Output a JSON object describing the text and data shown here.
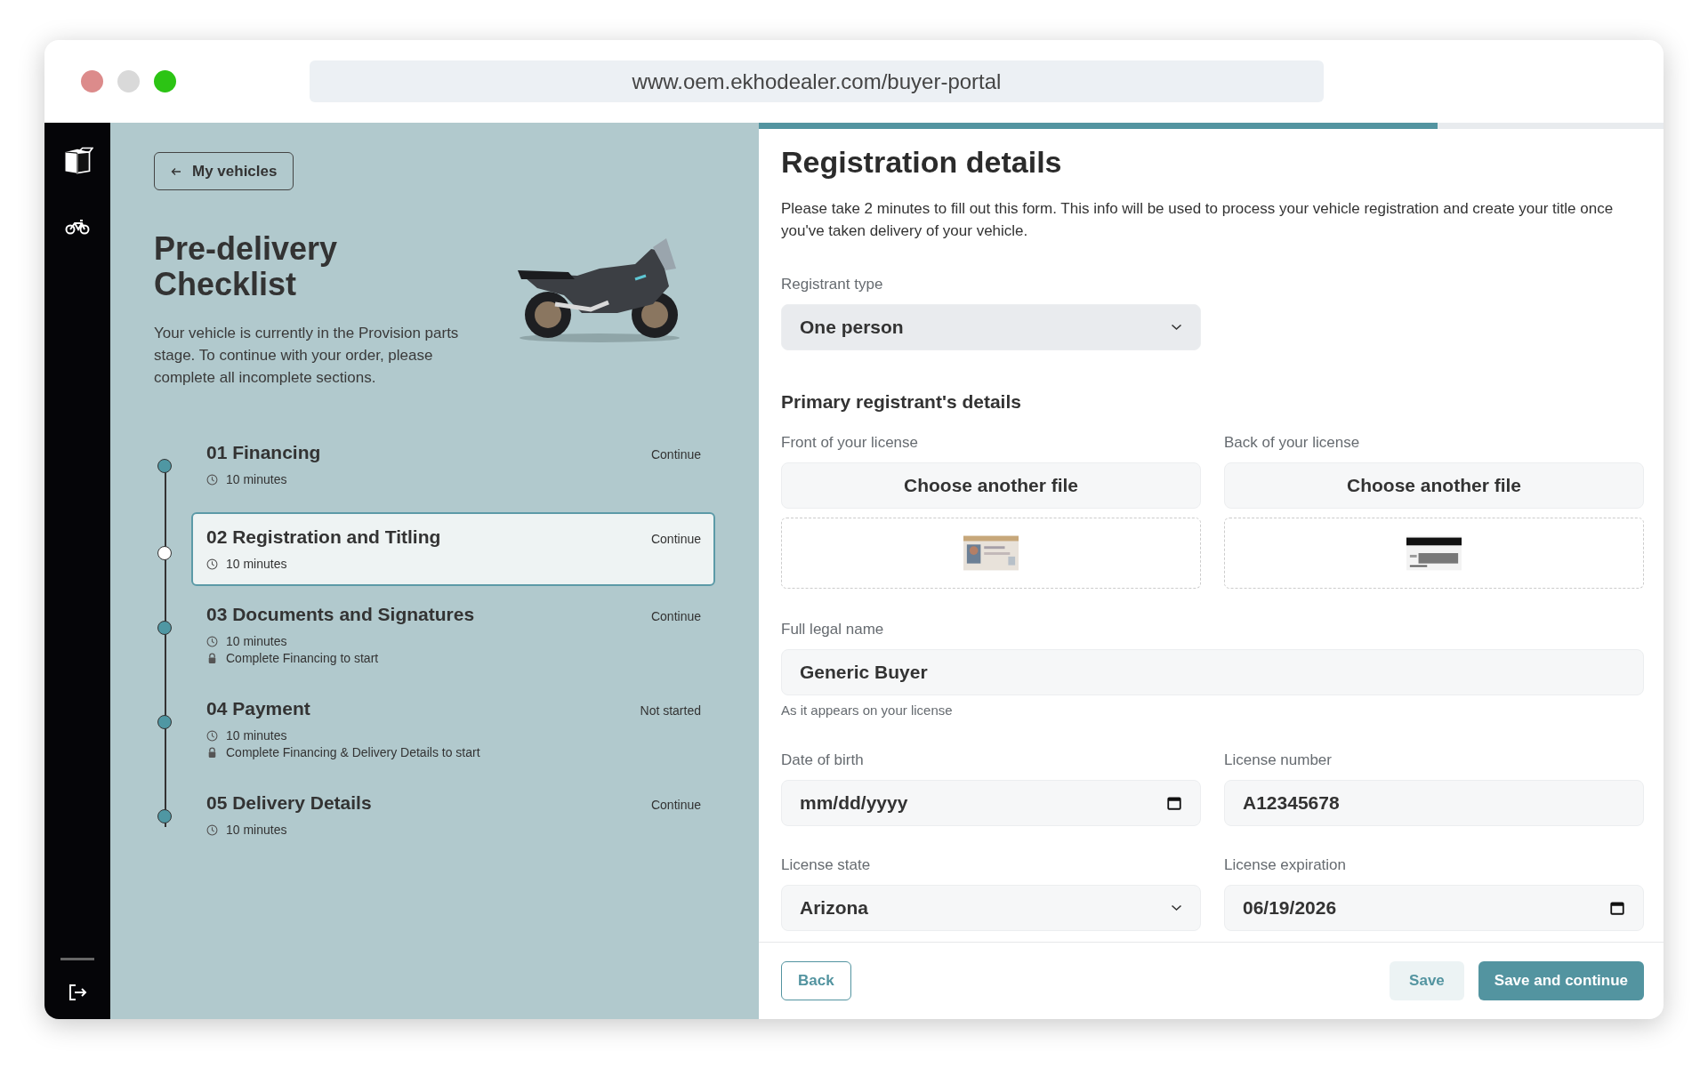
{
  "browser": {
    "url": "www.oem.ekhodealer.com/buyer-portal"
  },
  "nav": {
    "back_link": "My vehicles"
  },
  "checklist": {
    "title": "Pre-delivery Checklist",
    "description": "Your vehicle is currently in the Provision parts stage. To continue with your order, please complete all incomplete sections.",
    "steps": [
      {
        "title": "01 Financing",
        "status": "Continue",
        "duration": "10 minutes",
        "selected": false
      },
      {
        "title": "02 Registration and Titling",
        "status": "Continue",
        "duration": "10 minutes",
        "selected": true
      },
      {
        "title": "03 Documents and Signatures",
        "status": "Continue",
        "duration": "10 minutes",
        "lock_note": "Complete Financing to start",
        "selected": false
      },
      {
        "title": "04 Payment",
        "status": "Not started",
        "duration": "10 minutes",
        "lock_note": "Complete Financing & Delivery Details to start",
        "selected": false
      },
      {
        "title": "05 Delivery Details",
        "status": "Continue",
        "duration": "10 minutes",
        "selected": false
      }
    ]
  },
  "form": {
    "progress": {
      "level": 0.75
    },
    "title": "Registration details",
    "intro": "Please take 2 minutes to fill out this form. This info will be used to process your vehicle registration and create your title once you've taken delivery of your vehicle.",
    "registrant_type": {
      "label": "Registrant type",
      "value": "One person"
    },
    "section_title": "Primary registrant's details",
    "front_license": {
      "label": "Front of your license",
      "button": "Choose another file"
    },
    "back_license": {
      "label": "Back of your license",
      "button": "Choose another file"
    },
    "full_name": {
      "label": "Full legal name",
      "value": "Generic Buyer",
      "hint": "As it appears on your license"
    },
    "date_of_birth": {
      "label": "Date of birth",
      "placeholder": "mm/dd/yyyy"
    },
    "license_number": {
      "label": "License number",
      "value": "A12345678"
    },
    "license_state": {
      "label": "License state",
      "value": "Arizona"
    },
    "license_expiration": {
      "label": "License expiration",
      "value": "06/19/2026"
    }
  },
  "footer": {
    "back": "Back",
    "save": "Save",
    "save_continue": "Save and continue"
  }
}
